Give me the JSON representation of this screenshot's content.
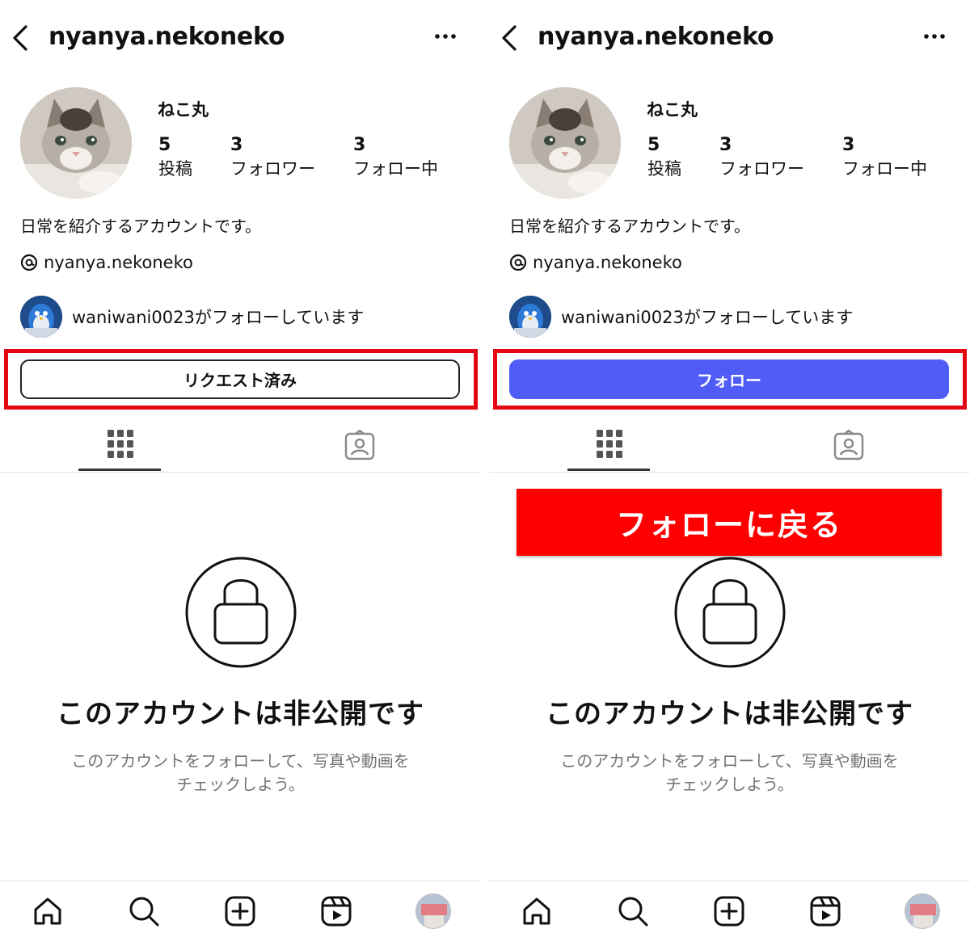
{
  "screens": [
    {
      "header": {
        "username": "nyanya.nekoneko"
      },
      "profile": {
        "display_name": "ねこ丸",
        "posts_count": "5",
        "posts_label": "投稿",
        "followers_count": "3",
        "followers_label": "フォロワー",
        "following_count": "3",
        "following_label": "フォロー中",
        "bio": "日常を紹介するアカウントです。",
        "threads_handle": "nyanya.nekoneko",
        "followed_by": "waniwani0023がフォローしています"
      },
      "action_button": "リクエスト済み",
      "private": {
        "title": "このアカウントは非公開です",
        "subtitle_line1": "このアカウントをフォローして、写真や動画を",
        "subtitle_line2": "チェックしよう。"
      }
    },
    {
      "header": {
        "username": "nyanya.nekoneko"
      },
      "profile": {
        "display_name": "ねこ丸",
        "posts_count": "5",
        "posts_label": "投稿",
        "followers_count": "3",
        "followers_label": "フォロワー",
        "following_count": "3",
        "following_label": "フォロー中",
        "bio": "日常を紹介するアカウントです。",
        "threads_handle": "nyanya.nekoneko",
        "followed_by": "waniwani0023がフォローしています"
      },
      "action_button": "フォロー",
      "banner": "フォローに戻る",
      "private": {
        "title": "このアカウントは非公開です",
        "subtitle_line1": "このアカウントをフォローして、写真や動画を",
        "subtitle_line2": "チェックしよう。"
      }
    }
  ],
  "icons": {
    "header": [
      "back-chevron-icon",
      "more-options-icon"
    ],
    "tabs": [
      "grid-icon",
      "tagged-icon"
    ],
    "nav": [
      "home-icon",
      "search-icon",
      "create-icon",
      "reels-icon",
      "profile-avatar"
    ]
  },
  "colors": {
    "follow_button": "#4f5cf6",
    "highlight": "#e30613",
    "banner": "#ff0000",
    "muted_text": "#737373"
  }
}
